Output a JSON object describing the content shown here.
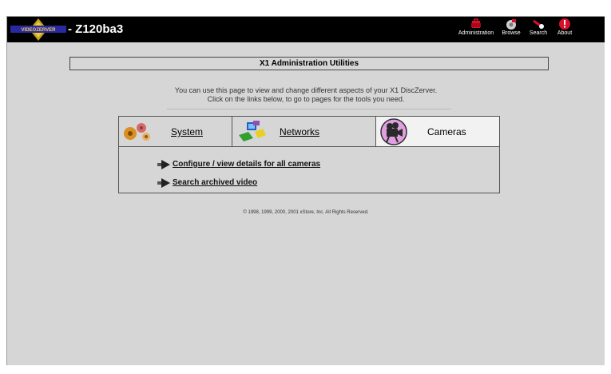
{
  "header": {
    "logo_text": "VIDEOZERVER",
    "device_name": "- Z120ba3"
  },
  "nav": [
    {
      "label": "Administration",
      "icon": "toolbox-icon",
      "color": "#d8102a"
    },
    {
      "label": "Browse",
      "icon": "browse-icon",
      "color": "#cfcfcf"
    },
    {
      "label": "Search",
      "icon": "search-flashlight-icon",
      "color": "#d8102a"
    },
    {
      "label": "About",
      "icon": "info-icon",
      "color": "#d8102a"
    }
  ],
  "main": {
    "heading": "X1 Administration Utilities",
    "intro_line1": "You can use this page to view and change different aspects of your X1 DiscZerver.",
    "intro_line2": "Click on the links below, to go to pages for the tools you need."
  },
  "tabs": [
    {
      "label": "System",
      "icon": "gears-icon",
      "selected": false
    },
    {
      "label": "Networks",
      "icon": "network-computers-icon",
      "selected": false
    },
    {
      "label": "Cameras",
      "icon": "camera-icon",
      "selected": true
    }
  ],
  "links": [
    {
      "label": "Configure / view details for all cameras"
    },
    {
      "label": "Search archived video"
    }
  ],
  "footer": {
    "copyright": "© 1998, 1999, 2000, 2001 xStore, Inc. All Rights Reserved."
  },
  "colors": {
    "page_background": "#d6d6d6",
    "titlebar": "#000000",
    "selected_tab": "#f2f2f2"
  }
}
